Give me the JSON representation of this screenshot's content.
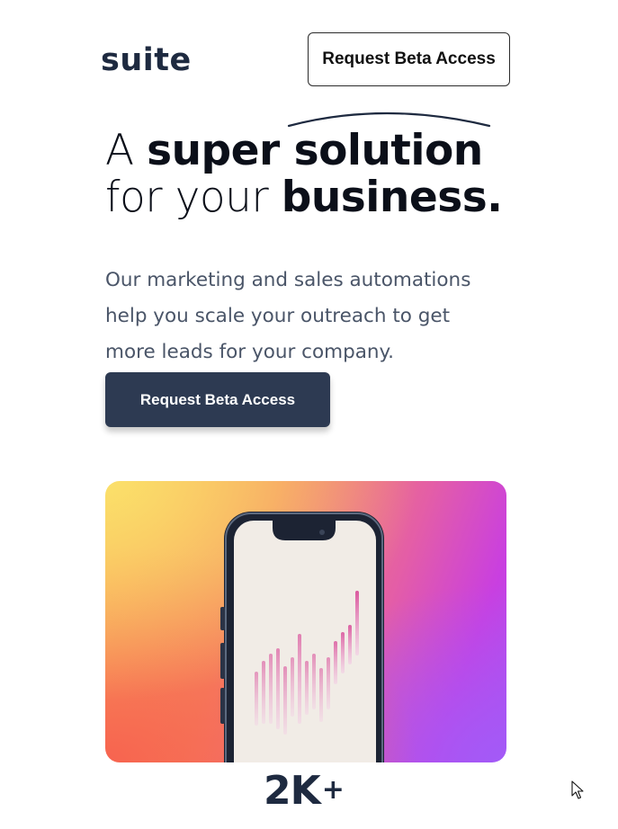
{
  "header": {
    "logo_text": "suite",
    "cta_label": "Request Beta Access"
  },
  "hero": {
    "headline_line1_light": "A ",
    "headline_line1_bold": "super solution",
    "headline_line2_light": "for your ",
    "headline_line2_bold": "business.",
    "description": "Our marketing and sales automations help you scale your outreach to get more leads for your company.",
    "cta_label": "Request Beta Access"
  },
  "stats": {
    "value": "2K",
    "suffix": "+"
  },
  "colors": {
    "brand_dark": "#1e2a40",
    "button_dark": "#2d3a52",
    "text_muted": "#4a5568"
  },
  "icons": {
    "cursor": "mouse-pointer-icon",
    "image": "phone-chart-image"
  }
}
